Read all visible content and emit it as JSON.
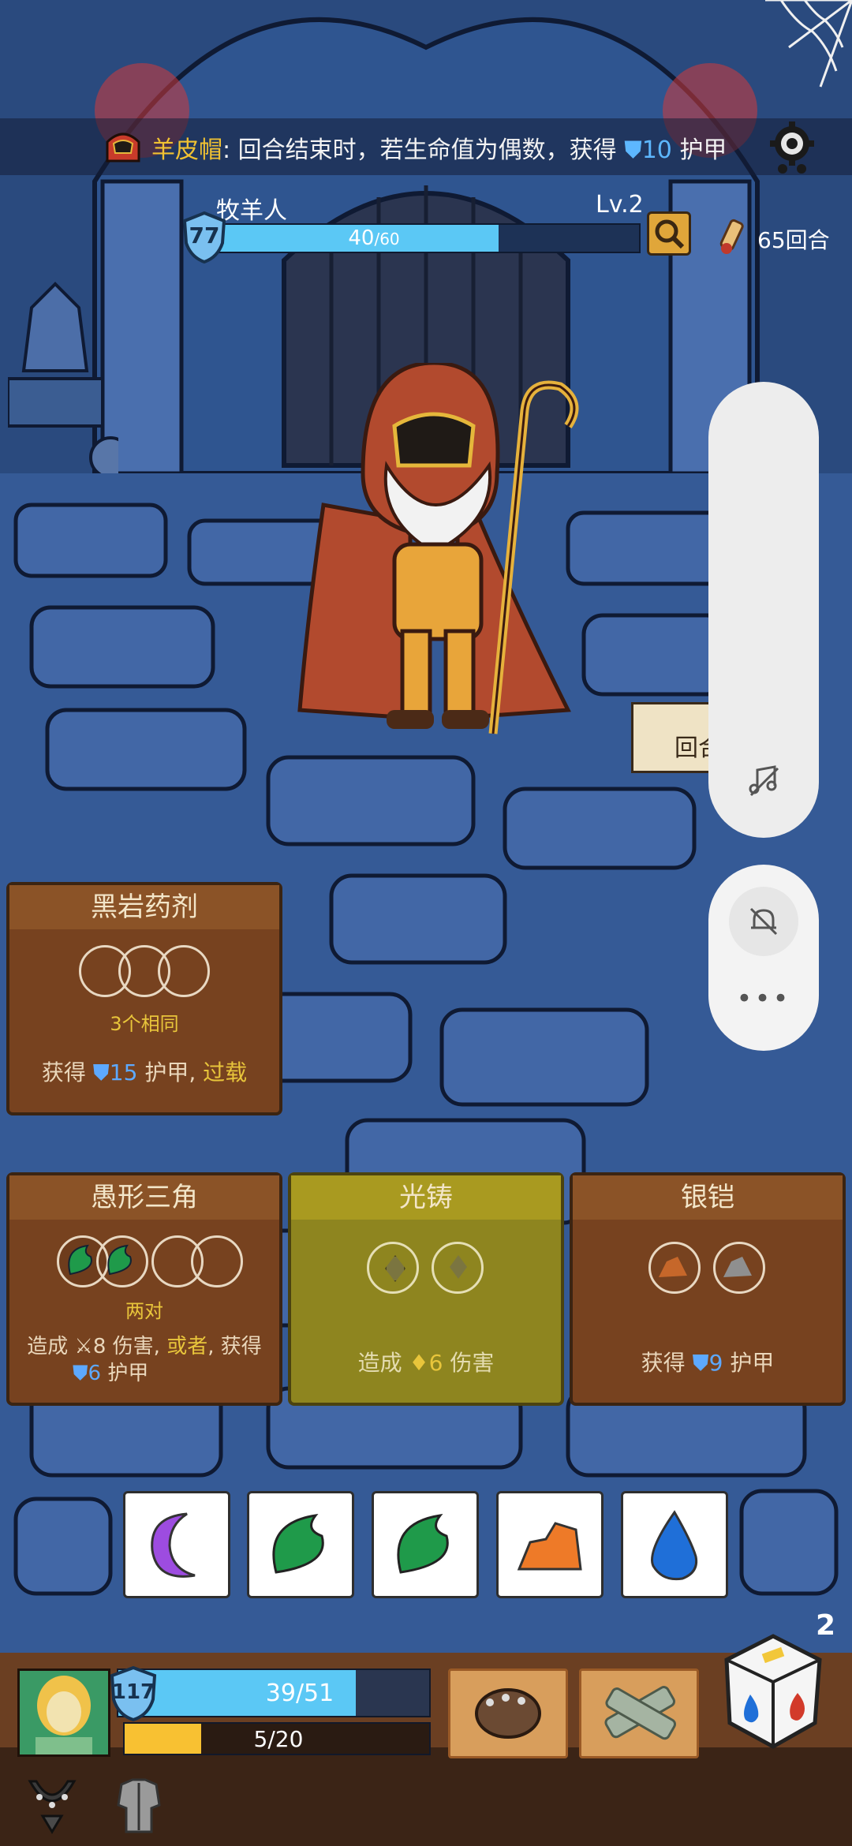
{
  "relic": {
    "name": "羊皮帽",
    "colon": ":",
    "text_before": "回合结束时，若生命值为偶数，获得",
    "armor_value": "10",
    "text_after": "护甲"
  },
  "enemy": {
    "name": "牧羊人",
    "level": "Lv.2",
    "shield": "77",
    "hp_current": "40",
    "hp_max": "/60",
    "hp_fraction": 0.667
  },
  "turns": "65回合",
  "round_tag": "回合",
  "cards": [
    {
      "title": "黑岩药剂",
      "condition": "3个相同",
      "effect_pre": "获得",
      "effect_num": "15",
      "effect_mid": "护甲,",
      "effect_kw": "过载"
    },
    {
      "title": "愚形三角",
      "condition": "两对",
      "line1_pre": "造成",
      "line1_num": "8",
      "line1_mid": "伤害,",
      "line1_kw": "或者",
      "line1_post": ", 获得",
      "line2_num": "6",
      "line2_post": "护甲"
    },
    {
      "title": "光铸",
      "effect_pre": "造成",
      "effect_num": "6",
      "effect_post": "伤害"
    },
    {
      "title": "银铠",
      "effect_pre": "获得",
      "effect_num": "9",
      "effect_post": "护甲"
    }
  ],
  "dice": [
    "moon-icon",
    "leaf-icon",
    "leaf-icon",
    "rock-icon",
    "water-drop-icon"
  ],
  "player": {
    "shield": "117",
    "hp": "39/51",
    "hp_fraction": 0.765,
    "energy": "5/20",
    "energy_fraction": 0.25
  },
  "dice_remaining": "2",
  "colors": {
    "accent_gold": "#e8c53b",
    "armor_blue": "#5da9ff",
    "hp_blue": "#5bc8f5",
    "energy_yellow": "#f8c132"
  }
}
